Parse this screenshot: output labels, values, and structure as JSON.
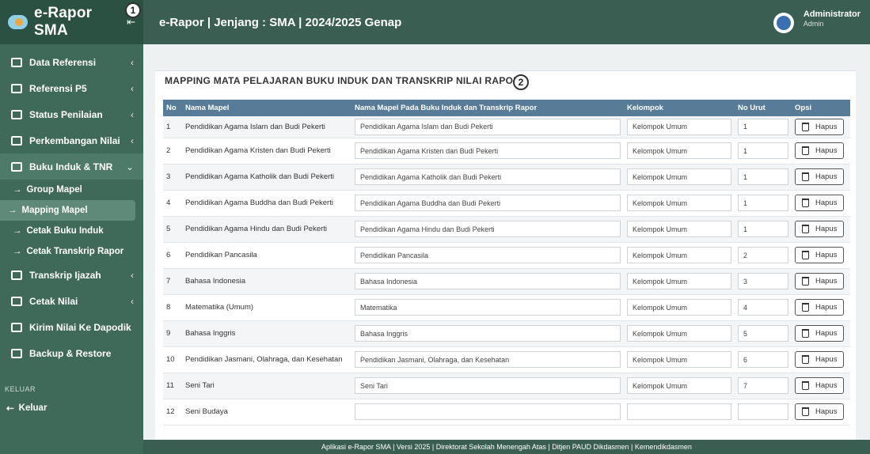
{
  "brand": {
    "title": "e-Rapor SMA",
    "collapse_icon": "collapse-left-icon"
  },
  "header": {
    "title": "e-Rapor | Jenjang : SMA | 2024/2025 Genap",
    "user_name": "Administrator",
    "user_role": "Admin"
  },
  "sidebar": {
    "items": [
      {
        "label": "Data Referensi",
        "icon": "monitor-icon"
      },
      {
        "label": "Referensi P5",
        "icon": "card-icon"
      },
      {
        "label": "Status Penilaian",
        "icon": "chart-line-icon"
      },
      {
        "label": "Perkembangan Nilai",
        "icon": "bar-chart-icon"
      },
      {
        "label": "Buku Induk & TNR",
        "icon": "book-icon"
      }
    ],
    "subitems": [
      {
        "label": "Group Mapel"
      },
      {
        "label": "Mapping Mapel"
      },
      {
        "label": "Cetak Buku Induk"
      },
      {
        "label": "Cetak Transkrip Rapor"
      }
    ],
    "items2": [
      {
        "label": "Transkrip Ijazah",
        "icon": "file-icon"
      },
      {
        "label": "Cetak Nilai",
        "icon": "printer-icon"
      },
      {
        "label": "Kirim Nilai Ke Dapodik",
        "icon": "upload-icon"
      },
      {
        "label": "Backup & Restore",
        "icon": "database-icon"
      }
    ],
    "section_label": "KELUAR",
    "logout_label": "Keluar",
    "badge1": "1"
  },
  "card": {
    "title": "MAPPING MATA PELAJARAN BUKU INDUK DAN TRANSKRIP NILAI RAPOR",
    "badge2": "2"
  },
  "table": {
    "headers": [
      "No",
      "Nama Mapel",
      "Nama Mapel Pada Buku Induk dan Transkrip Rapor",
      "Kelompok",
      "No Urut",
      "Opsi"
    ],
    "delete_label": "Hapus",
    "rows": [
      {
        "no": "1",
        "mapel": "Pendidikan Agama Islam dan Budi Pekerti",
        "nama": "Pendidikan Agama Islam dan Budi Pekerti",
        "kelompok": "Kelompok Umum",
        "urut": "1"
      },
      {
        "no": "2",
        "mapel": "Pendidikan Agama Kristen dan Budi Pekerti",
        "nama": "Pendidikan Agama Kristen dan Budi Pekerti",
        "kelompok": "Kelompok Umum",
        "urut": "1"
      },
      {
        "no": "3",
        "mapel": "Pendidikan Agama Katholik dan Budi Pekerti",
        "nama": "Pendidikan Agama Katholik dan Budi Pekerti",
        "kelompok": "Kelompok Umum",
        "urut": "1"
      },
      {
        "no": "4",
        "mapel": "Pendidikan Agama Buddha dan Budi Pekerti",
        "nama": "Pendidikan Agama Buddha dan Budi Pekerti",
        "kelompok": "Kelompok Umum",
        "urut": "1"
      },
      {
        "no": "5",
        "mapel": "Pendidikan Agama Hindu dan Budi Pekerti",
        "nama": "Pendidikan Agama Hindu dan Budi Pekerti",
        "kelompok": "Kelompok Umum",
        "urut": "1"
      },
      {
        "no": "6",
        "mapel": "Pendidikan Pancasila",
        "nama": "Pendidikan Pancasila",
        "kelompok": "Kelompok Umum",
        "urut": "2"
      },
      {
        "no": "7",
        "mapel": "Bahasa Indonesia",
        "nama": "Bahasa Indonesia",
        "kelompok": "Kelompok Umum",
        "urut": "3"
      },
      {
        "no": "8",
        "mapel": "Matematika (Umum)",
        "nama": "Matematika",
        "kelompok": "Kelompok Umum",
        "urut": "4"
      },
      {
        "no": "9",
        "mapel": "Bahasa Inggris",
        "nama": "Bahasa Inggris",
        "kelompok": "Kelompok Umum",
        "urut": "5"
      },
      {
        "no": "10",
        "mapel": "Pendidikan Jasmani, Olahraga, dan Kesehatan",
        "nama": "Pendidikan Jasmani, Olahraga, dan Kesehatan",
        "kelompok": "Kelompok Umum",
        "urut": "6"
      },
      {
        "no": "11",
        "mapel": "Seni Tari",
        "nama": "Seni Tari",
        "kelompok": "Kelompok Umum",
        "urut": "7"
      },
      {
        "no": "12",
        "mapel": "Seni Budaya",
        "nama": "",
        "kelompok": "",
        "urut": ""
      }
    ]
  },
  "footer": {
    "text": "Aplikasi e-Rapor SMA | Versi 2025 | Direktorat Sekolah Menengah Atas | Ditjen PAUD Dikdasmen | Kemendikdasmen"
  }
}
